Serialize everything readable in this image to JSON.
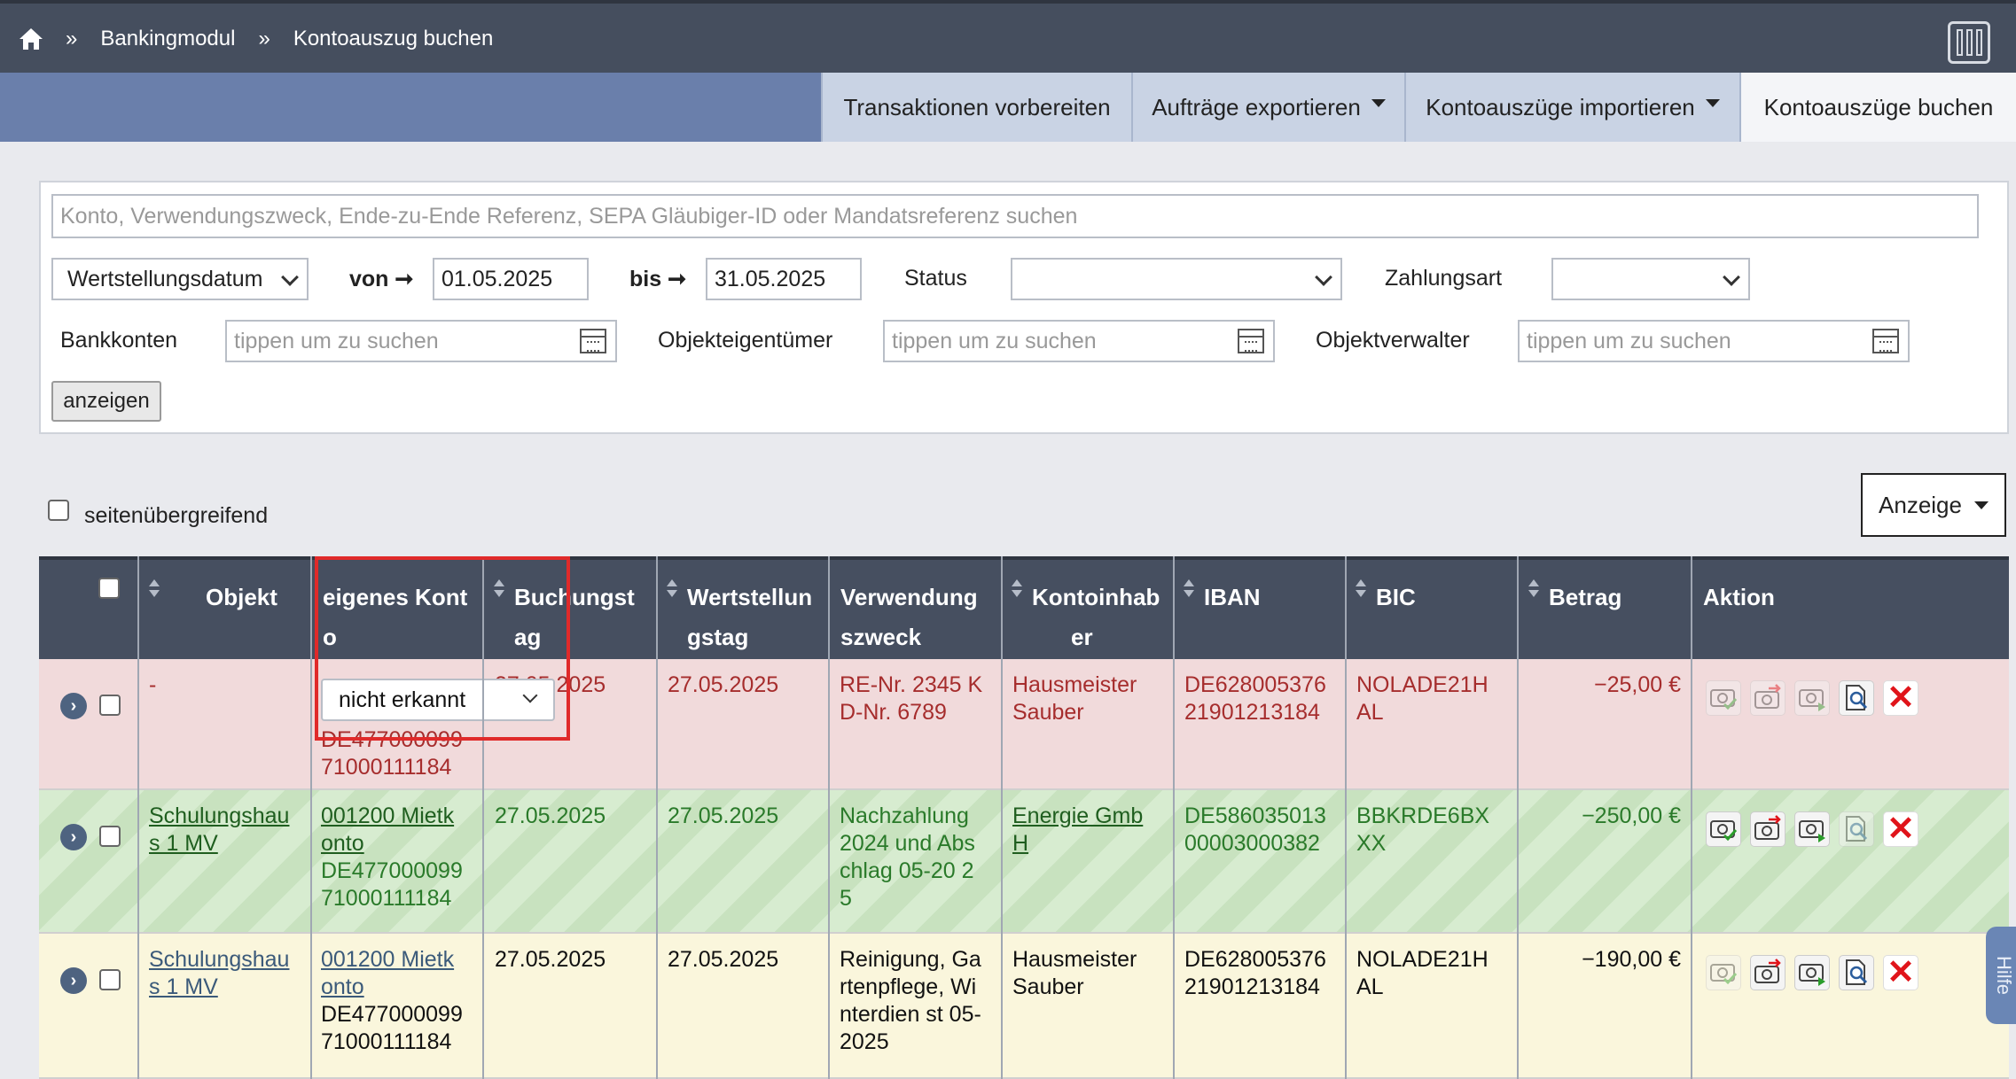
{
  "breadcrumb": {
    "home_icon": "home-icon",
    "separator": "»",
    "items": [
      "Bankingmodul",
      "Kontoauszug buchen"
    ]
  },
  "layout_icon": "columns-layout-icon",
  "tabs": [
    {
      "label": "Transaktionen vorbereiten",
      "dropdown": false,
      "active": false
    },
    {
      "label": "Aufträge exportieren",
      "dropdown": true,
      "active": false
    },
    {
      "label": "Kontoauszüge importieren",
      "dropdown": true,
      "active": false
    },
    {
      "label": "Kontoauszüge buchen",
      "dropdown": false,
      "active": true
    }
  ],
  "filter": {
    "search_placeholder": "Konto, Verwendungszweck, Ende-zu-Ende Referenz, SEPA Gläubiger-ID oder Mandatsreferenz suchen",
    "date_type": "Wertstellungsdatum",
    "from_label": "von",
    "arrow": "➞",
    "from_value": "01.05.2025",
    "to_label": "bis",
    "to_value": "31.05.2025",
    "status_label": "Status",
    "status_value": "",
    "payment_label": "Zahlungsart",
    "payment_value": "",
    "bank_label": "Bankkonten",
    "bank_placeholder": "tippen um zu suchen",
    "owner_label": "Objekteigentümer",
    "owner_placeholder": "tippen um zu suchen",
    "manager_label": "Objektverwalter",
    "manager_placeholder": "tippen um zu suchen",
    "show_button": "anzeigen"
  },
  "crosspage_label": "seitenübergreifend",
  "display_button": "Anzeige",
  "table": {
    "headers": {
      "objekt": "Objekt",
      "konto_1": "eigenes Kont",
      "konto_2": "o",
      "buchung_1": "Buchungst",
      "buchung_2": "ag",
      "wert_1": "Wertstellun",
      "wert_2": "gstag",
      "zweck_1": "Verwendung",
      "zweck_2": "szweck",
      "inhaber_1": "Kontoinhab",
      "inhaber_2": "er",
      "iban": "IBAN",
      "bic": "BIC",
      "betrag": "Betrag",
      "aktion": "Aktion"
    },
    "rows": [
      {
        "status": "unrecognized",
        "objekt": "-",
        "konto_select": "nicht erkannt",
        "konto_iban_1": "DE477000099",
        "konto_iban_2": "71000111184",
        "buchungstag": "27.05.2025",
        "wertstellungstag": "27.05.2025",
        "zweck": [
          "RE-Nr. 2345 K",
          "D-Nr. 6789"
        ],
        "inhaber": [
          "Hausmeister",
          "Sauber"
        ],
        "iban": [
          "DE628005376",
          "21901213184"
        ],
        "bic": [
          "NOLADE21H",
          "AL"
        ],
        "betrag": "−25,00 €"
      },
      {
        "status": "matched",
        "objekt": [
          "Schulungshau",
          "s 1 MV"
        ],
        "konto": [
          "001200 Mietk",
          "onto"
        ],
        "konto_iban_1": "DE477000099",
        "konto_iban_2": "71000111184",
        "buchungstag": "27.05.2025",
        "wertstellungstag": "27.05.2025",
        "zweck": [
          "Nachzahlung",
          "2024 und Abs",
          "chlag 05-20 2",
          "5"
        ],
        "inhaber": [
          "Energie Gmb",
          "H"
        ],
        "iban": [
          "DE586035013",
          "00003000382"
        ],
        "bic": [
          "BBKRDE6BX",
          "XX"
        ],
        "betrag": "−250,00 €"
      },
      {
        "status": "pending",
        "objekt": [
          "Schulungshau",
          "s 1 MV"
        ],
        "konto": [
          "001200 Mietk",
          "onto"
        ],
        "konto_iban_1": "DE477000099",
        "konto_iban_2": "71000111184",
        "buchungstag": "27.05.2025",
        "wertstellungstag": "27.05.2025",
        "zweck": [
          "Reinigung, Ga",
          "rtenpflege, Wi",
          "nterdien st 05-",
          "2025"
        ],
        "inhaber": [
          "Hausmeister",
          "Sauber"
        ],
        "iban": [
          "DE628005376",
          "21901213184"
        ],
        "bic": [
          "NOLADE21H",
          "AL"
        ],
        "betrag": "−190,00 €"
      }
    ]
  },
  "action_icons": [
    "confirm-booking-icon",
    "book-money-icon",
    "forward-money-icon",
    "inspect-document-icon",
    "delete-icon"
  ],
  "delete_glyph": "✕",
  "sidetab_label": "Hilfe",
  "colors": {
    "topbar": "#454e5e",
    "tabstrip": "#6a7fab",
    "row_red": "#f1dadb",
    "row_green": "#d7ecd0",
    "row_yellow": "#faf6dc",
    "highlight": "#e02a2a",
    "delete": "#e0141a"
  }
}
